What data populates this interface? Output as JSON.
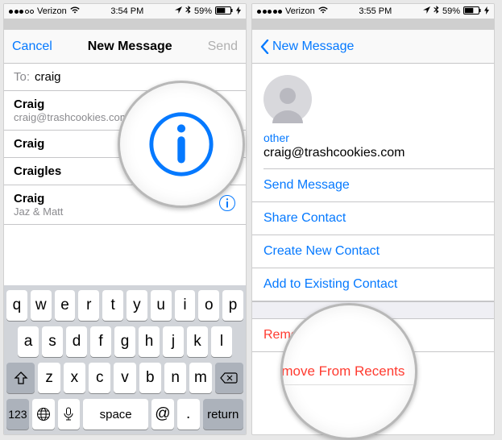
{
  "left": {
    "status": {
      "carrier": "Verizon",
      "time": "3:54 PM",
      "battery": "59%"
    },
    "nav": {
      "cancel": "Cancel",
      "title": "New Message",
      "send": "Send"
    },
    "to": {
      "label": "To:",
      "value": "craig"
    },
    "suggestions": [
      {
        "name": "Craig",
        "sub": "craig@trashcookies.com"
      },
      {
        "name": "Craig",
        "sub": ""
      },
      {
        "name": "Craigles",
        "sub": ""
      },
      {
        "name": "Craig",
        "sub": "Jaz & Matt"
      }
    ],
    "keyboard": {
      "row1": [
        "q",
        "w",
        "e",
        "r",
        "t",
        "y",
        "u",
        "i",
        "o",
        "p"
      ],
      "row2": [
        "a",
        "s",
        "d",
        "f",
        "g",
        "h",
        "j",
        "k",
        "l"
      ],
      "row3": [
        "z",
        "x",
        "c",
        "v",
        "b",
        "n",
        "m"
      ],
      "numkey": "123",
      "space": "space",
      "at": "@",
      "dot": ".",
      "return": "return"
    }
  },
  "right": {
    "status": {
      "carrier": "Verizon",
      "time": "3:55 PM",
      "battery": "59%"
    },
    "nav": {
      "back": "New Message"
    },
    "other_label": "other",
    "email": "craig@trashcookies.com",
    "actions": {
      "send": "Send Message",
      "share": "Share Contact",
      "create": "Create New Contact",
      "add": "Add to Existing Contact",
      "remove": "Remove From Recents"
    }
  },
  "callouts": {
    "remove": "Remove From Recents"
  }
}
